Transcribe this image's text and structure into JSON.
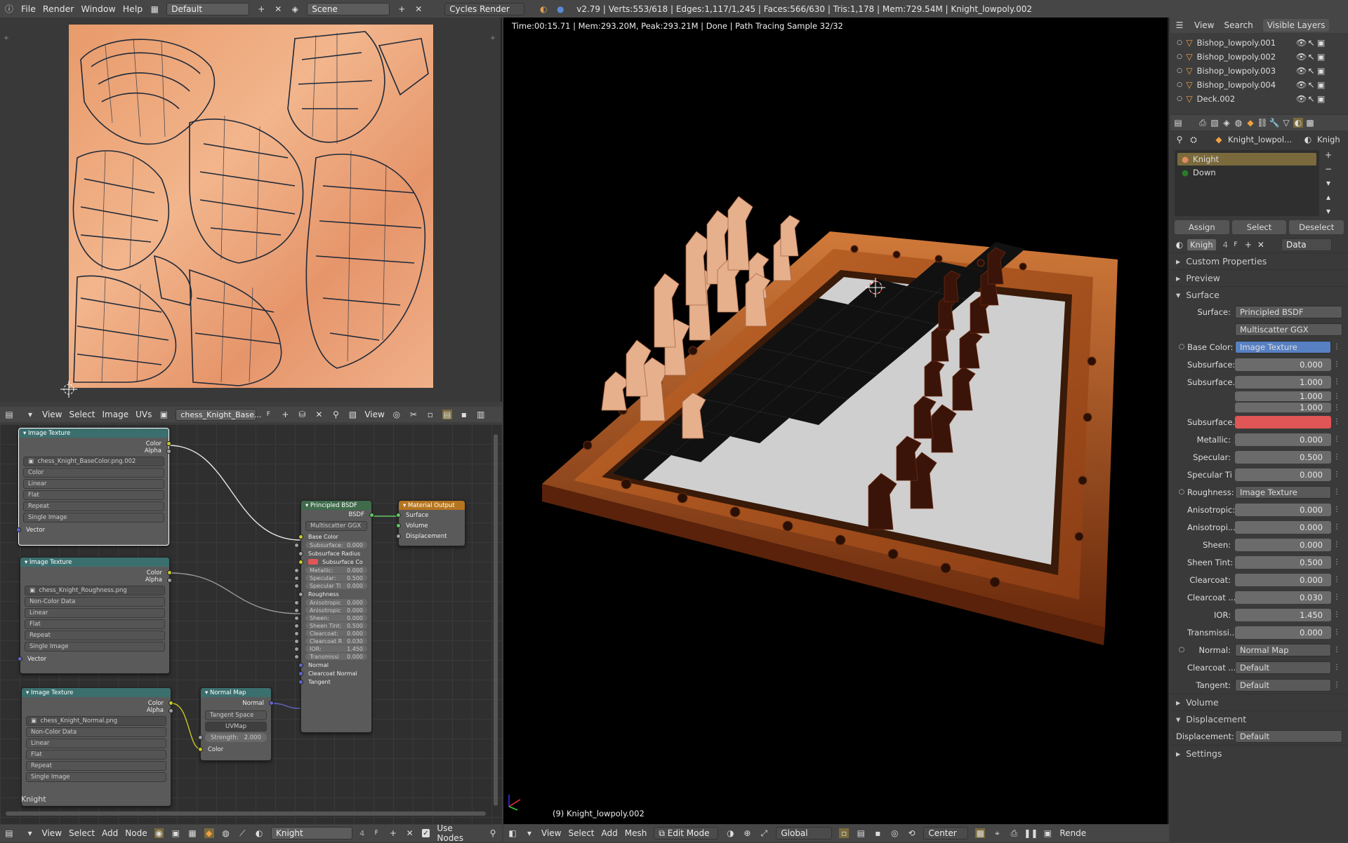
{
  "top": {
    "menus": [
      "File",
      "Render",
      "Window",
      "Help"
    ],
    "layout": "Default",
    "scene": "Scene",
    "engine": "Cycles Render",
    "stats": "v2.79 | Verts:553/618 | Edges:1,117/1,245 | Faces:566/630 | Tris:1,178 | Mem:729.54M | Knight_lowpoly.002"
  },
  "uv_header": {
    "menus": [
      "View",
      "Select",
      "Image",
      "UVs"
    ],
    "image": "chess_Knight_Base...",
    "view": "View"
  },
  "node_header": {
    "menus": [
      "View",
      "Select",
      "Add",
      "Node"
    ],
    "material": "Knight",
    "users": "4",
    "use_nodes": "Use Nodes"
  },
  "node_label": "Knight",
  "nodes": {
    "tex1": {
      "title": "Image Texture",
      "out1": "Color",
      "out2": "Alpha",
      "file": "chess_Knight_BaseColor.png.002",
      "opts": [
        "Color",
        "Linear",
        "Flat",
        "Repeat",
        "Single Image"
      ],
      "in": "Vector"
    },
    "tex2": {
      "title": "Image Texture",
      "out1": "Color",
      "out2": "Alpha",
      "file": "chess_Knight_Roughness.png",
      "opts": [
        "Non-Color Data",
        "Linear",
        "Flat",
        "Repeat",
        "Single Image"
      ],
      "in": "Vector"
    },
    "tex3": {
      "title": "Image Texture",
      "out1": "Color",
      "out2": "Alpha",
      "file": "chess_Knight_Normal.png",
      "opts": [
        "Non-Color Data",
        "Linear",
        "Flat",
        "Repeat",
        "Single Image"
      ]
    },
    "normal": {
      "title": "Normal Map",
      "out": "Normal",
      "space": "Tangent Space",
      "uv": "UVMap",
      "strength_l": "Strength:",
      "strength": "2.000",
      "in": "Color"
    },
    "bsdf": {
      "title": "Principled BSDF",
      "out": "BSDF",
      "dist": "Multiscatter GGX",
      "rows": [
        [
          "Base Color",
          ""
        ],
        [
          "Subsurface:",
          "0.000"
        ],
        [
          "Subsurface Radius",
          ""
        ],
        [
          "Subsurface Co",
          ""
        ],
        [
          "Metallic:",
          "0.000"
        ],
        [
          "Specular:",
          "0.500"
        ],
        [
          "Specular Ti",
          "0.000"
        ],
        [
          "Roughness",
          ""
        ],
        [
          "Anisotropic",
          "0.000"
        ],
        [
          "Anisotropic",
          "0.000"
        ],
        [
          "Sheen:",
          "0.000"
        ],
        [
          "Sheen Tint:",
          "0.500"
        ],
        [
          "Clearcoat:",
          "0.000"
        ],
        [
          "Clearcoat R",
          "0.030"
        ],
        [
          "IOR:",
          "1.450"
        ],
        [
          "Transmissi",
          "0.000"
        ],
        [
          "Normal",
          ""
        ],
        [
          "Clearcoat Normal",
          ""
        ],
        [
          "Tangent",
          ""
        ]
      ]
    },
    "output": {
      "title": "Material Output",
      "ins": [
        "Surface",
        "Volume",
        "Displacement"
      ]
    }
  },
  "viewport": {
    "status": "Time:00:15.71 | Mem:293.20M, Peak:293.21M | Done | Path Tracing Sample 32/32",
    "object": "(9) Knight_lowpoly.002",
    "header": [
      "View",
      "Select",
      "Add",
      "Mesh"
    ],
    "mode": "Edit Mode",
    "orient": "Global",
    "pivot": "Center",
    "render": "Rende"
  },
  "outliner": {
    "tabs": [
      "View",
      "Search",
      "Visible Layers"
    ],
    "items": [
      "Bishop_lowpoly.001",
      "Bishop_lowpoly.002",
      "Bishop_lowpoly.003",
      "Bishop_lowpoly.004",
      "Deck.002"
    ]
  },
  "props": {
    "crumb1": "Knight_lowpol...",
    "crumb2": "Knigh",
    "slots": [
      "Knight",
      "Down"
    ],
    "assign": "Assign",
    "select": "Select",
    "deselect": "Deselect",
    "mat": "Knigh",
    "mat_users": "4",
    "data": "Data",
    "panels": {
      "custom": "Custom Properties",
      "preview": "Preview",
      "surface": "Surface",
      "volume": "Volume",
      "displacement": "Displacement",
      "settings": "Settings"
    },
    "surface_l": "Surface:",
    "surface_v": "Principled BSDF",
    "dist": "Multiscatter GGX",
    "rows": [
      [
        "Base Color:",
        "Image Texture",
        "dd"
      ],
      [
        "Subsurface:",
        "0.000",
        "nm"
      ],
      [
        "Subsurface...",
        "1.000",
        "nm"
      ],
      [
        "",
        "1.000",
        "nm"
      ],
      [
        "",
        "1.000",
        "nm"
      ],
      [
        "Subsurface...",
        "",
        "col"
      ],
      [
        "Metallic:",
        "0.000",
        "nm"
      ],
      [
        "Specular:",
        "0.500",
        "nm"
      ],
      [
        "Specular Ti",
        "0.000",
        "nm"
      ],
      [
        "Roughness:",
        "Image Texture",
        "dd"
      ],
      [
        "Anisotropic:",
        "0.000",
        "nm"
      ],
      [
        "Anisotropi...",
        "0.000",
        "nm"
      ],
      [
        "Sheen:",
        "0.000",
        "nm"
      ],
      [
        "Sheen Tint:",
        "0.500",
        "nm"
      ],
      [
        "Clearcoat:",
        "0.000",
        "nm"
      ],
      [
        "Clearcoat ...",
        "0.030",
        "nm"
      ],
      [
        "IOR:",
        "1.450",
        "nm"
      ],
      [
        "Transmissi...",
        "0.000",
        "nm"
      ],
      [
        "Normal:",
        "Normal Map",
        "dd"
      ],
      [
        "Clearcoat ...",
        "Default",
        "dd"
      ],
      [
        "Tangent:",
        "Default",
        "dd"
      ]
    ],
    "disp_l": "Displacement:",
    "disp_v": "Default"
  }
}
